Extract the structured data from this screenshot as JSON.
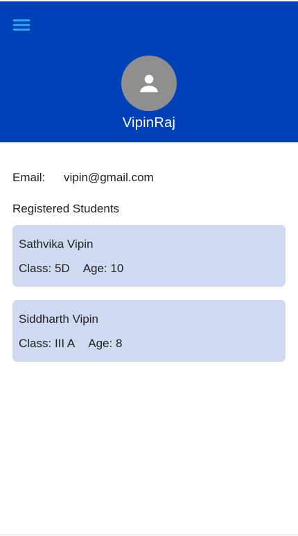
{
  "header": {
    "background_color": "#0040b8",
    "menu_icon": "hamburger-menu-icon",
    "menu_icon_color": "#29b6f6",
    "avatar_icon": "person-icon",
    "avatar_background": "#8f8f8f",
    "username": "VipinRaj"
  },
  "profile": {
    "email_label": "Email:",
    "email_value": "vipin@gmail.com"
  },
  "students_section": {
    "title": "Registered Students",
    "card_color": "#cfdaf0",
    "students": [
      {
        "name": "Sathvika Vipin",
        "class_text": "Class: 5D",
        "age_text": "Age: 10"
      },
      {
        "name": "Siddharth Vipin",
        "class_text": "Class: III A",
        "age_text": "Age: 8"
      }
    ]
  }
}
